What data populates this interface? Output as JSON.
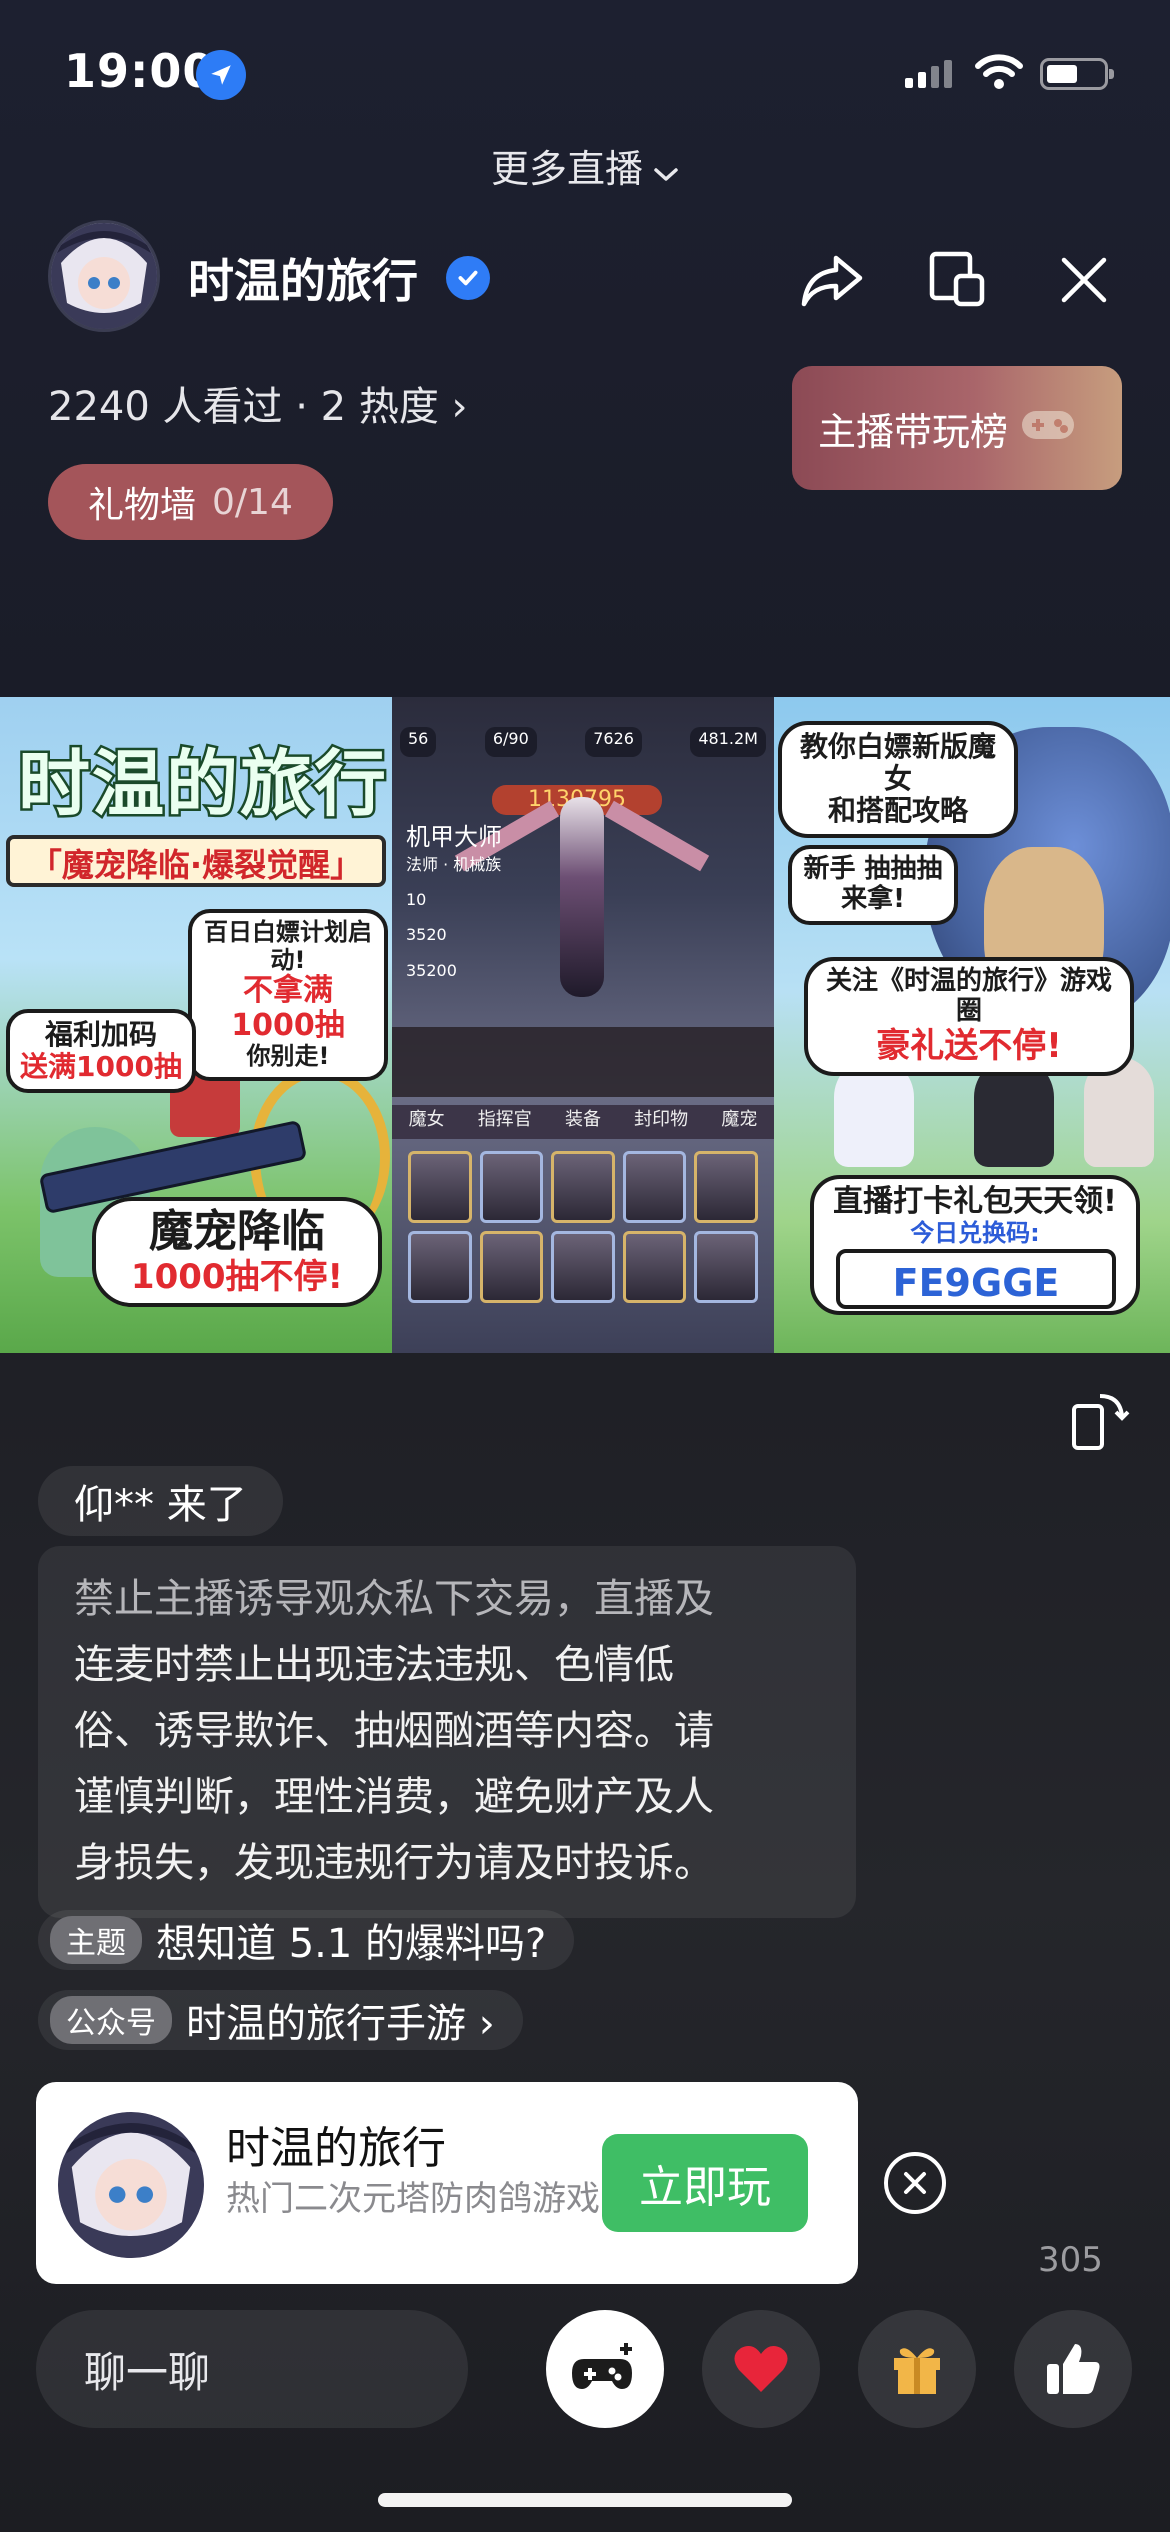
{
  "status_bar": {
    "time": "19:00"
  },
  "header": {
    "more_live": "更多直播",
    "streamer_name": "时温的旅行",
    "stats": "2240 人看过 · 2 热度 ›",
    "rank_button": "主播带玩榜",
    "gift_wall_label": "礼物墙",
    "gift_wall_count": "0/14"
  },
  "video": {
    "panel1": {
      "title": "时温的旅行",
      "subtitle": "「魔宠降临·爆裂觉醒」",
      "bubble1_line1": "百日白嫖计划启动!",
      "bubble1_line2": "不拿满1000抽",
      "bubble1_line3": "你别走!",
      "bubble2_line1": "福利加码",
      "bubble2_line2": "送满1000抽",
      "bubble3_line1": "魔宠降临",
      "bubble3_line2": "1000抽不停!"
    },
    "panel2": {
      "top_left": "56",
      "energy": "6/90",
      "gems": "7626",
      "gold": "481.2M",
      "power": "1130795",
      "class_title": "机甲大师",
      "side_lines": [
        "法师 · 机械族",
        "10",
        "3520",
        "35200"
      ],
      "bottom_tabs": [
        "魔女",
        "指挥官",
        "装备",
        "封印物",
        "魔宠"
      ]
    },
    "panel3": {
      "bubble1_line1": "教你白嫖新版魔女",
      "bubble1_line2": "和搭配攻略",
      "bubble2_line1": "新手 抽抽抽",
      "bubble2_line2": "来拿!",
      "bubble3_line1": "关注《时温的旅行》游戏圈",
      "bubble3_line2": "豪礼送不停!",
      "bubble4_line1": "直播打卡礼包天天领!",
      "bubble4_line2": "今日兑换码:",
      "code": "FE9GGE"
    }
  },
  "chat": {
    "enter_message": "仰** 来了",
    "notice_line1": "禁止主播诱导观众私下交易，直播及",
    "notice_line2": "连麦时禁止出现违法违规、色情低",
    "notice_line3": "俗、诱导欺诈、抽烟酗酒等内容。请",
    "notice_line4": "谨慎判断，理性消费，避免财产及人",
    "notice_line5": "身损失，发现违规行为请及时投诉。",
    "topic_tag": "主题",
    "topic_text": "想知道 5.1 的爆料吗?",
    "official_tag": "公众号",
    "official_text": "时温的旅行手游 ›"
  },
  "game_card": {
    "title": "时温的旅行",
    "desc": "热门二次元塔防肉鸽游戏",
    "play_button": "立即玩"
  },
  "like_count": "305",
  "bottom_bar": {
    "chat_placeholder": "聊一聊"
  },
  "colors": {
    "accent_blue": "#2f7cf6",
    "play_green": "#3fbe65",
    "gift_wall_bg": "#a4555a",
    "heart_red": "#e8253a",
    "gift_gold": "#f2b648"
  }
}
